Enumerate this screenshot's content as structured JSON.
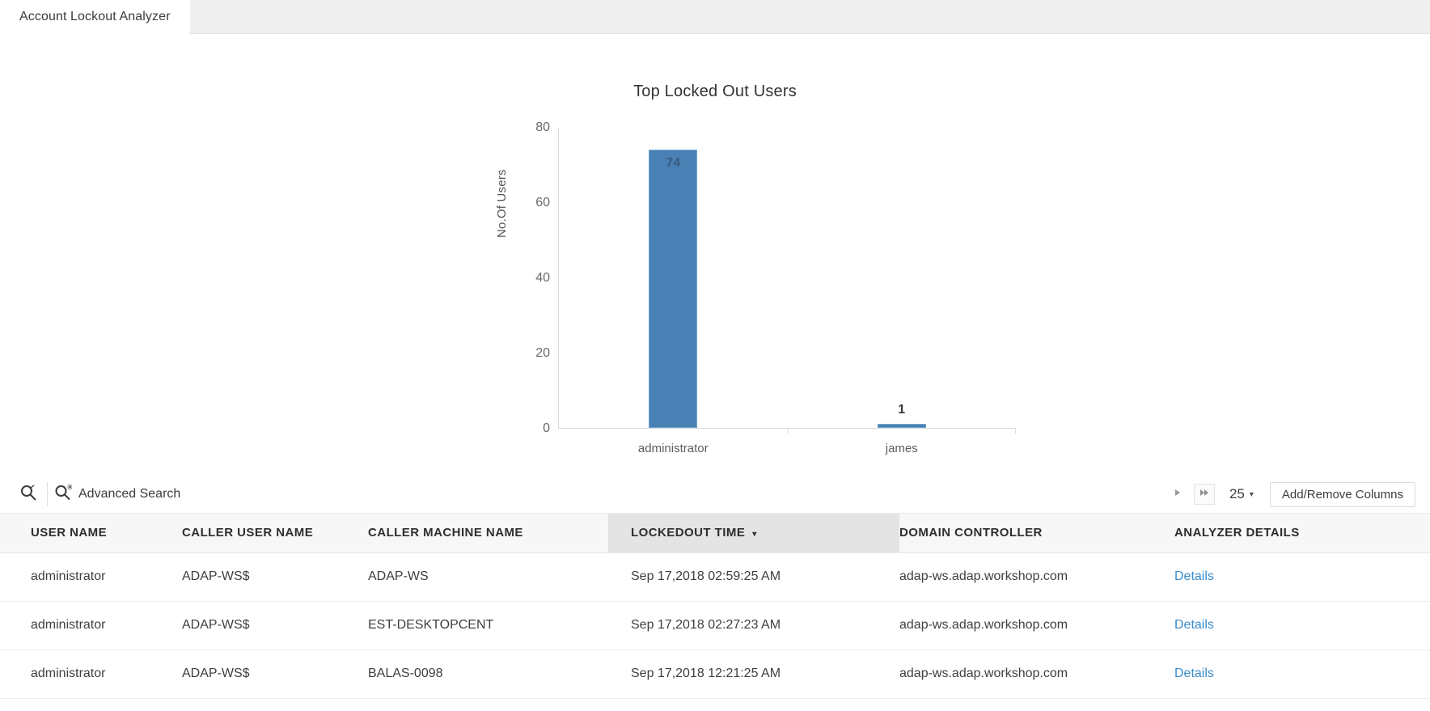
{
  "tabs": [
    {
      "label": "Account Lockout Analyzer",
      "active": true
    }
  ],
  "chart_data": {
    "type": "bar",
    "title": "Top Locked Out Users",
    "xlabel": "",
    "ylabel": "No.Of Users",
    "categories": [
      "administrator",
      "james"
    ],
    "values": [
      74,
      1
    ],
    "value_labels": [
      "74",
      "1"
    ],
    "ylim": [
      0,
      80
    ],
    "yticks": [
      0,
      20,
      40,
      60,
      80
    ],
    "ytick_labels": [
      "0",
      "20",
      "40",
      "60",
      "80"
    ],
    "grid": false,
    "legend": false,
    "bar_color": "#4a81b4"
  },
  "toolbar": {
    "search_icon": "search-icon",
    "advanced_search_icon": "search-advanced-icon",
    "advanced_search_label": "Advanced Search",
    "next_page_icon": "play-right-icon",
    "last_page_icon": "skip-forward-icon",
    "page_size_value": "25",
    "page_size_caret": "▾",
    "add_remove_columns_label": "Add/Remove Columns"
  },
  "table": {
    "columns": [
      {
        "key": "user_name",
        "label": "USER NAME",
        "sorted": false
      },
      {
        "key": "caller_user_name",
        "label": "CALLER USER NAME",
        "sorted": false
      },
      {
        "key": "caller_machine_name",
        "label": "CALLER MACHINE NAME",
        "sorted": false
      },
      {
        "key": "lockedout_time",
        "label": "LOCKEDOUT TIME",
        "sorted": true,
        "sort_dir": "▾"
      },
      {
        "key": "domain_controller",
        "label": "DOMAIN CONTROLLER",
        "sorted": false
      },
      {
        "key": "analyzer_details",
        "label": "ANALYZER DETAILS",
        "sorted": false
      }
    ],
    "rows": [
      {
        "user_name": "administrator",
        "caller_user_name": "ADAP-WS$",
        "caller_machine_name": "ADAP-WS",
        "lockedout_time": "Sep 17,2018 02:59:25 AM",
        "domain_controller": "adap-ws.adap.workshop.com",
        "analyzer_details": "Details"
      },
      {
        "user_name": "administrator",
        "caller_user_name": "ADAP-WS$",
        "caller_machine_name": "EST-DESKTOPCENT",
        "lockedout_time": "Sep 17,2018 02:27:23 AM",
        "domain_controller": "adap-ws.adap.workshop.com",
        "analyzer_details": "Details"
      },
      {
        "user_name": "administrator",
        "caller_user_name": "ADAP-WS$",
        "caller_machine_name": "BALAS-0098",
        "lockedout_time": "Sep 17,2018 12:21:25 AM",
        "domain_controller": "adap-ws.adap.workshop.com",
        "analyzer_details": "Details"
      }
    ]
  },
  "colors": {
    "bar": "#4a81b4",
    "link": "#3a8bc8",
    "sorted_header_bg": "#e4e4e4",
    "header_bg": "#f7f7f7",
    "tab_rest_bg": "#efefef"
  }
}
